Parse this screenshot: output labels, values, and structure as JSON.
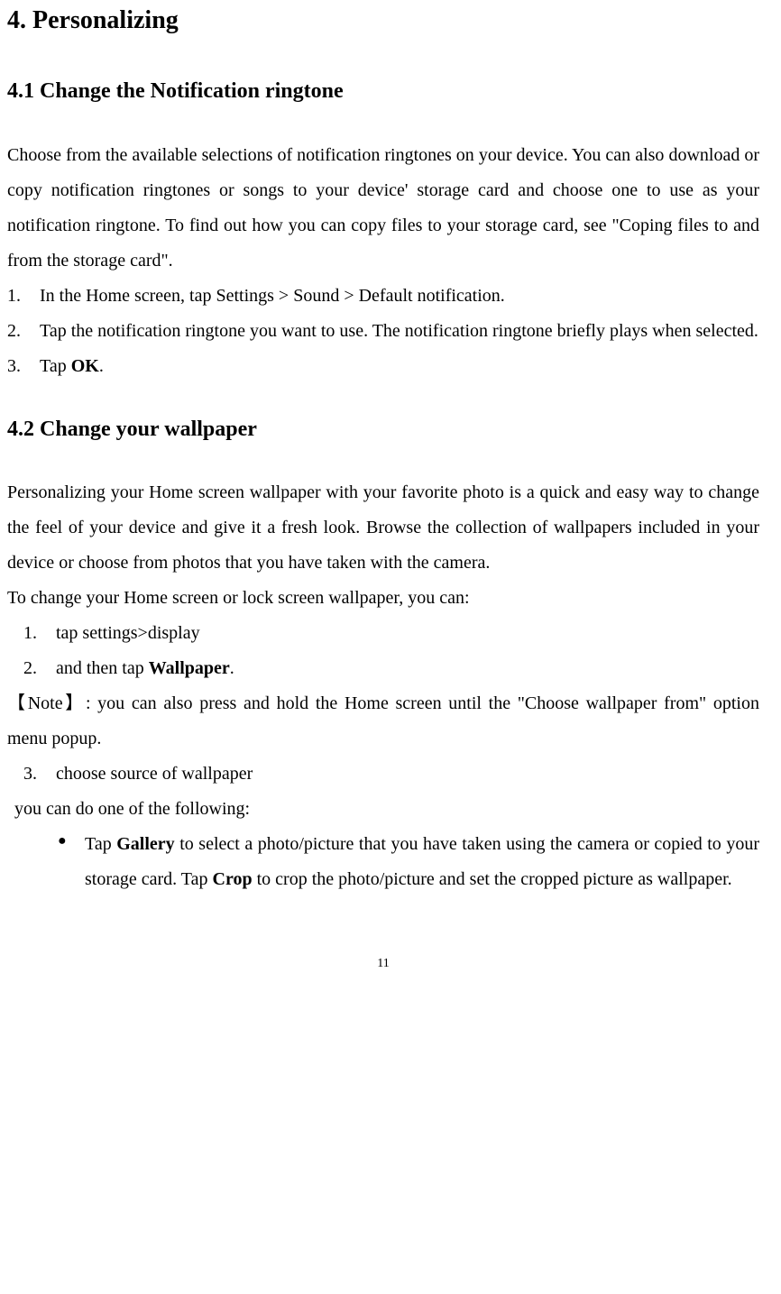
{
  "heading_main": "4. Personalizing",
  "section1": {
    "heading": "4.1 Change the Notification ringtone",
    "intro": "Choose from the available selections of notification ringtones on your device. You can also download or copy notification ringtones or songs to your device' storage card and choose one to use as your notification ringtone. To find out how you can copy files to your storage card, see \"Coping files to and from the storage card\".",
    "steps": [
      {
        "num": "1.",
        "text": "In the Home screen, tap Settings > Sound > Default notification."
      },
      {
        "num": "2.",
        "text": "Tap the notification ringtone you want to use. The notification ringtone briefly plays when selected."
      },
      {
        "num": "3.",
        "text_prefix": "Tap ",
        "text_bold": "OK",
        "text_suffix": "."
      }
    ]
  },
  "section2": {
    "heading": "4.2 Change your wallpaper",
    "intro": "Personalizing your Home screen wallpaper with your favorite photo is a quick and easy way to change the feel of your device and give it a fresh look. Browse the collection of wallpapers included in your device or choose from photos that you have taken with the camera.",
    "lead": "To change your Home screen or lock screen wallpaper, you can:",
    "steps_a": [
      {
        "num": "1.",
        "text": "tap settings>display"
      },
      {
        "num": "2.",
        "text_prefix": "and then tap ",
        "text_bold": "Wallpaper",
        "text_suffix": "."
      }
    ],
    "note": "【Note】: you can also press and hold the Home screen until the \"Choose wallpaper from\" option menu popup.",
    "steps_b": [
      {
        "num": "3.",
        "text": "choose source of wallpaper"
      }
    ],
    "sub_lead": "you can do one of the following:",
    "bullets": [
      {
        "pre": "Tap ",
        "bold1": "Gallery",
        "mid": " to select a photo/picture that you have taken using the camera or copied to your storage card. Tap ",
        "bold2": "Crop",
        "post": " to crop the photo/picture and set the cropped picture as wallpaper."
      }
    ]
  },
  "page_number": "11"
}
